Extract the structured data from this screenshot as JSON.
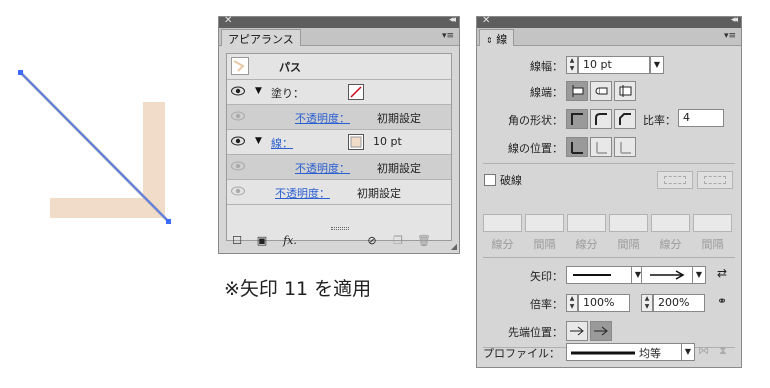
{
  "caption": "※矢印 11 を適用",
  "appearance_panel": {
    "tab_label": "アピアランス",
    "path_label": "パス",
    "fill_label": "塗り：",
    "opacity_label": "不透明度：",
    "opacity_value": "初期設定",
    "stroke_label": "線：",
    "stroke_value": "10 pt",
    "fx_label": "fx."
  },
  "stroke_panel": {
    "tab_label": "線",
    "weight_label": "線幅：",
    "weight_value": "10 pt",
    "cap_label": "線端：",
    "corner_label": "角の形状：",
    "ratio_label": "比率：",
    "ratio_value": "4",
    "align_label": "線の位置：",
    "dashed_label": "破線",
    "dash_label": "線分",
    "gap_label": "間隔",
    "arrow_label": "矢印：",
    "scale_label": "倍率：",
    "scale_start": "100%",
    "scale_end": "200%",
    "arrow_pos_label": "先端位置：",
    "profile_label": "プロファイル：",
    "profile_value": "均等"
  },
  "colors": {
    "stroke_fill": "#f0dcc8",
    "selection": "#3c6cff",
    "link_blue": "#2a5fd0"
  }
}
